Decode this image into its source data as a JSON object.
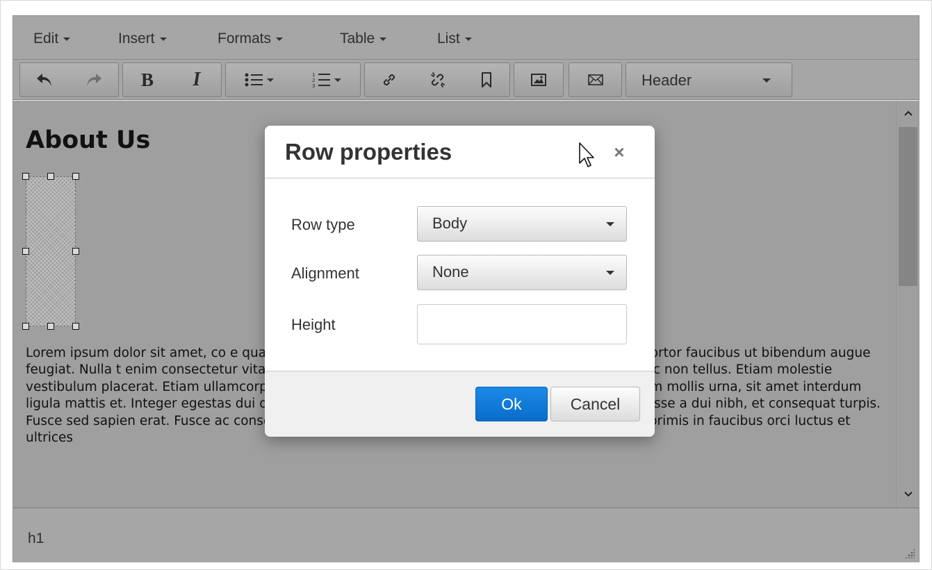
{
  "menubar": {
    "items": [
      {
        "label": "Edit"
      },
      {
        "label": "Insert"
      },
      {
        "label": "Formats"
      },
      {
        "label": "Table"
      },
      {
        "label": "List"
      }
    ]
  },
  "toolbar": {
    "bold_label": "B",
    "italic_label": "I",
    "format_select": {
      "value": "Header"
    },
    "icons": [
      "undo-icon",
      "redo-icon",
      "bullet-list-icon",
      "numbered-list-icon",
      "link-icon",
      "unlink-icon",
      "bookmark-icon",
      "image-icon",
      "envelope-icon"
    ]
  },
  "document": {
    "heading": "About Us",
    "paragraph": "Lorem ipsum dolor sit amet, co                                                    e quam, eget commodo mauris tristique laoreet. Nulla                                                   risus sed tortor faucibus ut bibendum augue feugiat. Nulla                                                    t enim consectetur vitae. Lorem ipsum dolor sit amet, co                                                    nsan mi facilisis iaculis nec non tellus. Etiam molestie vestibulum placerat. Etiam ullamcorper nunc sit amet ante pellentesque fringilla. Quisque aliquam mollis urna, sit amet interdum ligula mattis et. Integer egestas dui quis purus ullamcorper id volutpat libero vulputate. Suspendisse a dui nibh, et consequat turpis. Fusce sed sapien erat. Fusce ac consectetur quam. Suspendisse potenti. Vestibulum ante ipsum primis in faucibus orci luctus et ultrices"
  },
  "statusbar": {
    "path": "h1"
  },
  "dialog": {
    "title": "Row properties",
    "close_label": "×",
    "fields": {
      "row_type": {
        "label": "Row type",
        "value": "Body"
      },
      "alignment": {
        "label": "Alignment",
        "value": "None"
      },
      "height": {
        "label": "Height",
        "value": "",
        "placeholder": ""
      }
    },
    "ok_label": "Ok",
    "cancel_label": "Cancel"
  },
  "colors": {
    "ok_button": "#0a6ccb",
    "overlay_gray": "#a6a6a6"
  }
}
